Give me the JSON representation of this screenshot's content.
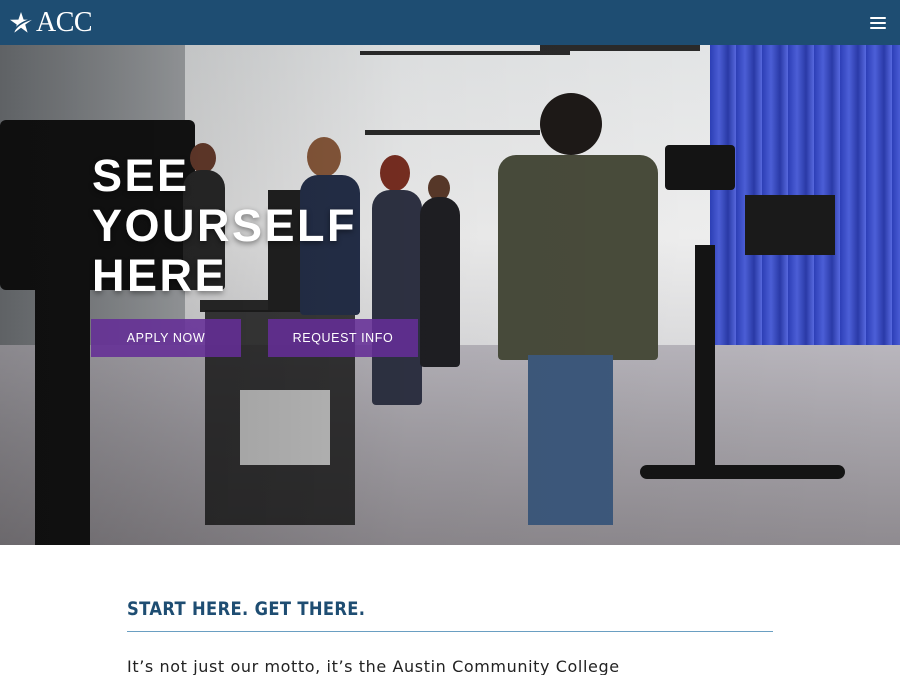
{
  "header": {
    "logo_text": "ACC",
    "logo_icon": "star-icon",
    "menu_icon": "hamburger-menu-icon",
    "background": "#1e4d72"
  },
  "hero": {
    "image_description": "",
    "heading_lines": [
      "SEE",
      "YOURSELF",
      "HERE"
    ],
    "apply_label": "APPLY NOW",
    "request_label": "REQUEST INFO",
    "button_color": "#642d96"
  },
  "main": {
    "section_title": "START HERE. GET THERE.",
    "lead_text": "It’s not just our motto, it’s the Austin Community College",
    "title_color": "#1e4d72",
    "rule_color": "#6a9fc2"
  }
}
